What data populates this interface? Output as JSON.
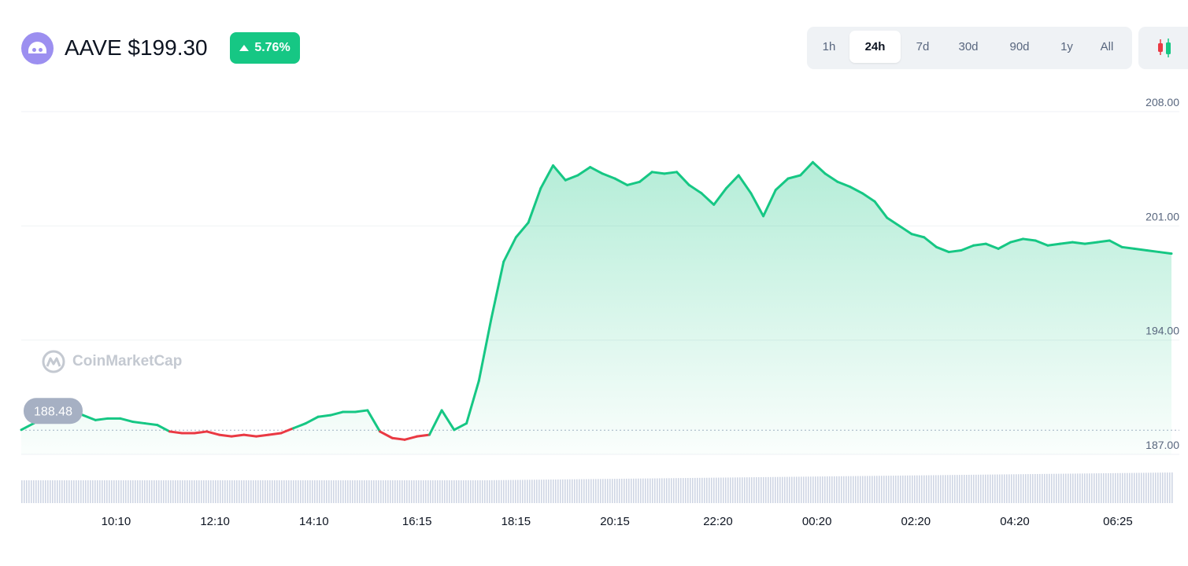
{
  "header": {
    "title": "AAVE $199.30",
    "change": "5.76%",
    "ranges": [
      "1h",
      "24h",
      "7d",
      "30d",
      "90d",
      "1y",
      "All"
    ],
    "active_range": "24h",
    "watermark": "CoinMarketCap",
    "icons": {
      "logo": "aave-ghost-icon",
      "change": "triangle-up-icon",
      "chart_type": "candlestick-icon",
      "watermark": "coinmarketcap-icon"
    }
  },
  "colors": {
    "up": "#16c784",
    "down": "#ea3943",
    "grid": "#eff2f5",
    "axis_text": "#58667e",
    "volume": "#cfd6e4"
  },
  "chart_data": {
    "type": "area",
    "title": "",
    "xlabel": "",
    "ylabel": "",
    "ylim": [
      187,
      208
    ],
    "yticks": [
      "208.00",
      "201.00",
      "194.00",
      "187.00"
    ],
    "xticks": [
      "10:10",
      "12:10",
      "14:10",
      "16:15",
      "18:15",
      "20:15",
      "22:20",
      "00:20",
      "02:20",
      "04:20",
      "06:25"
    ],
    "reference_value": 188.48,
    "reference_label": "188.48",
    "series": [
      {
        "points": [
          [
            "08:15",
            188.5
          ],
          [
            "08:30",
            188.9
          ],
          [
            "08:45",
            189.3
          ],
          [
            "09:00",
            189.8
          ],
          [
            "09:15",
            189.8
          ],
          [
            "09:30",
            189.4
          ],
          [
            "09:45",
            189.1
          ],
          [
            "10:00",
            189.2
          ],
          [
            "10:15",
            189.2
          ],
          [
            "10:30",
            189.0
          ],
          [
            "10:45",
            188.9
          ],
          [
            "11:00",
            188.8
          ],
          [
            "11:15",
            188.4
          ],
          [
            "11:30",
            188.3
          ],
          [
            "11:45",
            188.3
          ],
          [
            "12:00",
            188.4
          ],
          [
            "12:15",
            188.2
          ],
          [
            "12:30",
            188.1
          ],
          [
            "12:45",
            188.2
          ],
          [
            "13:00",
            188.1
          ],
          [
            "13:15",
            188.2
          ],
          [
            "13:30",
            188.3
          ],
          [
            "13:45",
            188.6
          ],
          [
            "14:00",
            188.9
          ],
          [
            "14:15",
            189.3
          ],
          [
            "14:30",
            189.4
          ],
          [
            "14:45",
            189.6
          ],
          [
            "15:00",
            189.6
          ],
          [
            "15:15",
            189.7
          ],
          [
            "15:30",
            188.4
          ],
          [
            "15:45",
            188.0
          ],
          [
            "16:00",
            187.9
          ],
          [
            "16:15",
            188.1
          ],
          [
            "16:30",
            188.2
          ],
          [
            "16:45",
            189.7
          ],
          [
            "17:00",
            188.5
          ],
          [
            "17:15",
            188.9
          ],
          [
            "17:30",
            191.5
          ],
          [
            "17:45",
            195.3
          ],
          [
            "18:00",
            198.8
          ],
          [
            "18:15",
            200.3
          ],
          [
            "18:30",
            201.2
          ],
          [
            "18:45",
            203.3
          ],
          [
            "19:00",
            204.7
          ],
          [
            "19:15",
            203.8
          ],
          [
            "19:30",
            204.1
          ],
          [
            "19:45",
            204.6
          ],
          [
            "20:00",
            204.2
          ],
          [
            "20:15",
            203.9
          ],
          [
            "20:30",
            203.5
          ],
          [
            "20:45",
            203.7
          ],
          [
            "21:00",
            204.3
          ],
          [
            "21:15",
            204.2
          ],
          [
            "21:30",
            204.3
          ],
          [
            "21:45",
            203.5
          ],
          [
            "22:00",
            203.0
          ],
          [
            "22:15",
            202.3
          ],
          [
            "22:30",
            203.3
          ],
          [
            "22:45",
            204.1
          ],
          [
            "23:00",
            203.0
          ],
          [
            "23:15",
            201.6
          ],
          [
            "23:30",
            203.2
          ],
          [
            "23:45",
            203.9
          ],
          [
            "00:00",
            204.1
          ],
          [
            "00:15",
            204.9
          ],
          [
            "00:30",
            204.2
          ],
          [
            "00:45",
            203.7
          ],
          [
            "01:00",
            203.4
          ],
          [
            "01:15",
            203.0
          ],
          [
            "01:30",
            202.5
          ],
          [
            "01:45",
            201.5
          ],
          [
            "02:00",
            201.0
          ],
          [
            "02:15",
            200.5
          ],
          [
            "02:30",
            200.3
          ],
          [
            "02:45",
            199.7
          ],
          [
            "03:00",
            199.4
          ],
          [
            "03:15",
            199.5
          ],
          [
            "03:30",
            199.8
          ],
          [
            "03:45",
            199.9
          ],
          [
            "04:00",
            199.6
          ],
          [
            "04:15",
            200.0
          ],
          [
            "04:30",
            200.2
          ],
          [
            "04:45",
            200.1
          ],
          [
            "05:00",
            199.8
          ],
          [
            "05:15",
            199.9
          ],
          [
            "05:30",
            200.0
          ],
          [
            "05:45",
            199.9
          ],
          [
            "06:00",
            200.0
          ],
          [
            "06:15",
            200.1
          ],
          [
            "06:30",
            199.7
          ],
          [
            "06:45",
            199.6
          ],
          [
            "07:00",
            199.5
          ],
          [
            "07:15",
            199.4
          ],
          [
            "07:30",
            199.3
          ]
        ]
      }
    ],
    "grid": true
  }
}
